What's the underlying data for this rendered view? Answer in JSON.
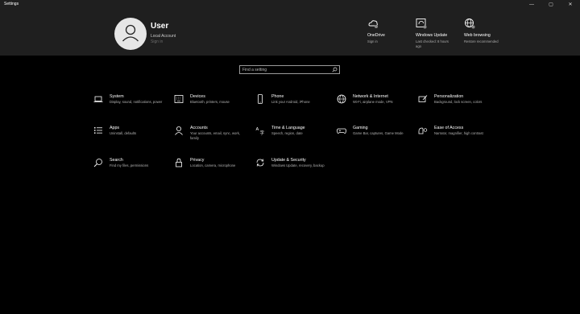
{
  "window": {
    "title": "Settings",
    "minimize": "—",
    "maximize": "▢",
    "close": "✕"
  },
  "user": {
    "name": "User",
    "account_type": "Local Account",
    "sign_in": "Sign in"
  },
  "header_items": [
    {
      "label": "OneDrive",
      "sub": "Sign in",
      "icon": "onedrive-icon"
    },
    {
      "label": "Windows Update",
      "sub": "Last checked: 8 hours ago",
      "icon": "windows-update-icon"
    },
    {
      "label": "Web browsing",
      "sub": "Restore recommended",
      "icon": "web-browsing-icon"
    }
  ],
  "search": {
    "placeholder": "Find a setting"
  },
  "categories": [
    {
      "name": "System",
      "desc": "Display, sound, notifications, power",
      "icon": "laptop-icon"
    },
    {
      "name": "Devices",
      "desc": "Bluetooth, printers, mouse",
      "icon": "keyboard-icon"
    },
    {
      "name": "Phone",
      "desc": "Link your Android, iPhone",
      "icon": "phone-icon"
    },
    {
      "name": "Network & Internet",
      "desc": "Wi-Fi, airplane mode, VPN",
      "icon": "globe-icon"
    },
    {
      "name": "Personalization",
      "desc": "Background, lock screen, colors",
      "icon": "brush-icon"
    },
    {
      "name": "Apps",
      "desc": "Uninstall, defaults",
      "icon": "apps-list-icon"
    },
    {
      "name": "Accounts",
      "desc": "Your accounts, email, sync, work, family",
      "icon": "person-icon"
    },
    {
      "name": "Time & Language",
      "desc": "Speech, region, date",
      "icon": "time-language-icon"
    },
    {
      "name": "Gaming",
      "desc": "Game Bar, captures, Game Mode",
      "icon": "gamepad-icon"
    },
    {
      "name": "Ease of Access",
      "desc": "Narrator, magnifier, high contrast",
      "icon": "ease-of-access-icon"
    },
    {
      "name": "Search",
      "desc": "Find my files, permissions",
      "icon": "search-icon"
    },
    {
      "name": "Privacy",
      "desc": "Location, camera, microphone",
      "icon": "lock-icon"
    },
    {
      "name": "Update & Security",
      "desc": "Windows Update, recovery, backup",
      "icon": "sync-icon"
    }
  ]
}
